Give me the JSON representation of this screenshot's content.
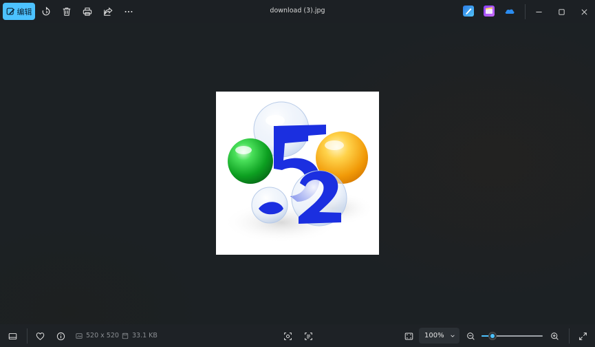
{
  "toolbar": {
    "edit_label": "编辑",
    "edit_icon": "edit-image-icon",
    "rotate_icon": "rotate-icon",
    "delete_icon": "delete-icon",
    "print_icon": "print-icon",
    "share_icon": "share-icon",
    "more_icon": "more-options-icon"
  },
  "window": {
    "title": "download (3).jpg",
    "apps": [
      "designer-icon",
      "clipchamp-icon",
      "onedrive-icon"
    ],
    "minimize_icon": "minimize-icon",
    "maximize_icon": "maximize-icon",
    "close_icon": "close-icon"
  },
  "image": {
    "numeral": "5",
    "colors": {
      "numeral": "#1b2fe0",
      "green": "#19b82e",
      "orange": "#f4b21c"
    }
  },
  "status": {
    "dimensions": "520 x 520",
    "file_size": "33.1 KB",
    "zoom_value": "100%",
    "zoom_fraction": 0.18
  },
  "colors": {
    "accent": "#4cc2ff",
    "background": "#1c2024"
  }
}
